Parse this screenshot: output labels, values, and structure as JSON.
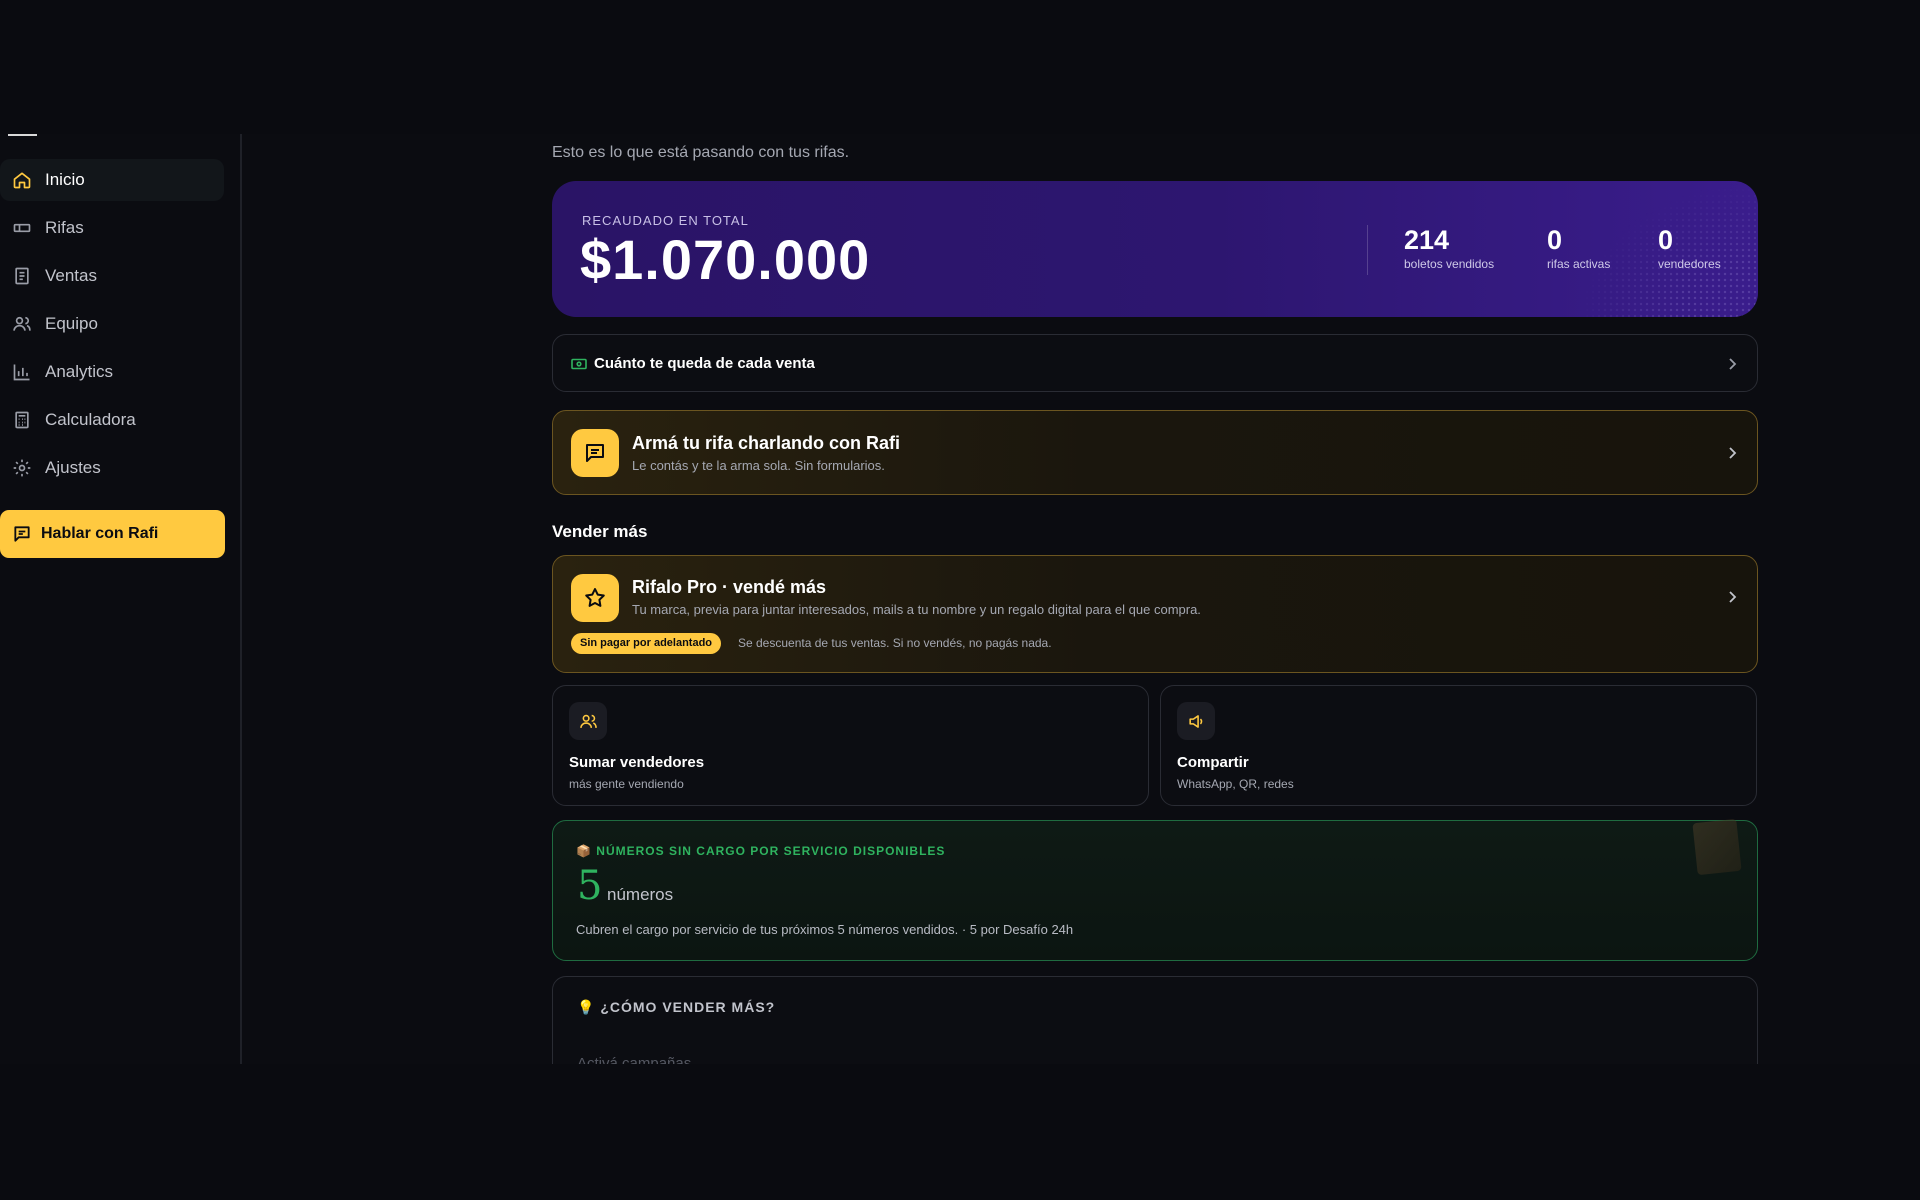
{
  "sidebar": {
    "items": [
      {
        "label": "Inicio",
        "icon": "home-icon",
        "active": true
      },
      {
        "label": "Rifas",
        "icon": "ticket-icon"
      },
      {
        "label": "Ventas",
        "icon": "receipt-icon"
      },
      {
        "label": "Equipo",
        "icon": "users-icon"
      },
      {
        "label": "Analytics",
        "icon": "bar-chart-icon"
      },
      {
        "label": "Calculadora",
        "icon": "calculator-icon"
      },
      {
        "label": "Ajustes",
        "icon": "gear-icon"
      }
    ],
    "cta_label": "Hablar con Rafi"
  },
  "header": {
    "subtitle": "Esto es lo que está pasando con tus rifas."
  },
  "hero": {
    "label": "RECAUDADO EN TOTAL",
    "value": "$1.070.000",
    "stats": [
      {
        "value": "214",
        "label": "boletos vendidos"
      },
      {
        "value": "0",
        "label": "rifas activas"
      },
      {
        "value": "0",
        "label": "vendedores"
      }
    ]
  },
  "earnings_row": {
    "label": "Cuánto te queda de cada venta"
  },
  "rafi_card": {
    "title": "Armá tu rifa charlando con Rafi",
    "subtitle": "Le contás y te la arma sola. Sin formularios."
  },
  "sell_more": {
    "section_title": "Vender más",
    "pro_card": {
      "title": "Rifalo Pro · vendé más",
      "subtitle": "Tu marca, previa para juntar interesados, mails a tu nombre y un regalo digital para el que compra.",
      "badge": "Sin pagar por adelantado",
      "note": "Se descuenta de tus ventas. Si no vendés, no pagás nada."
    },
    "cards": [
      {
        "title": "Sumar vendedores",
        "subtitle": "más gente vendiendo",
        "icon": "users-icon"
      },
      {
        "title": "Compartir",
        "subtitle": "WhatsApp, QR, redes",
        "icon": "megaphone-icon"
      }
    ]
  },
  "free_numbers": {
    "label": "📦 NÚMEROS SIN CARGO POR SERVICIO DISPONIBLES",
    "count": "5",
    "unit": "números",
    "description": "Cubren el cargo por servicio de tus próximos 5 números vendidos. · 5 por Desafío 24h"
  },
  "tips": {
    "title": "💡 ¿CÓMO VENDER MÁS?",
    "first_item": "Activá campañas"
  },
  "colors": {
    "accent": "#ffc940",
    "hero_purple": "#2d1670",
    "success_green": "#2fb35f",
    "background": "#0b0c11"
  }
}
